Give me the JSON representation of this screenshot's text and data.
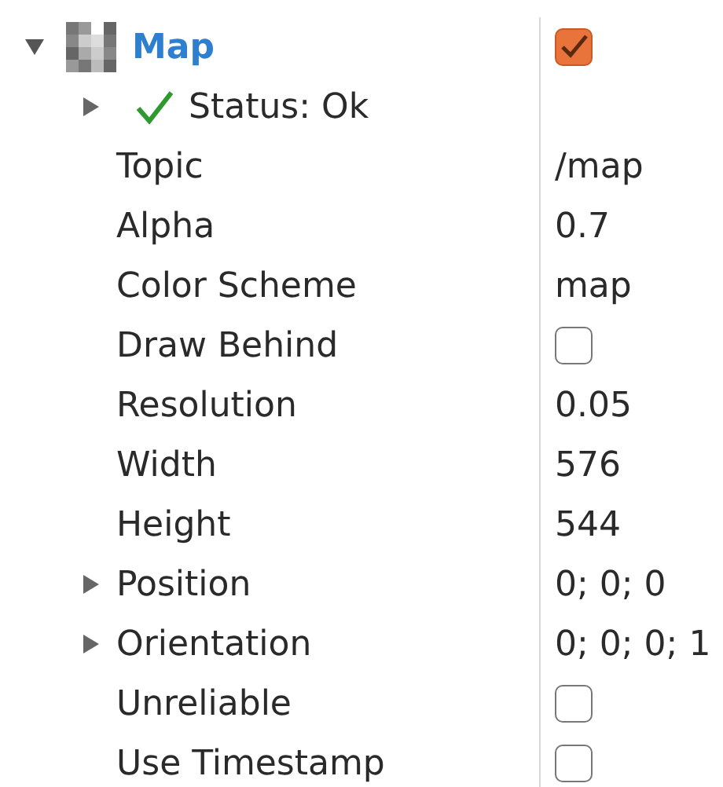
{
  "display": {
    "name": "Map",
    "expanded": true,
    "checked": true
  },
  "status": {
    "label": "Status: Ok",
    "expanded": false
  },
  "properties": [
    {
      "kind": "text",
      "label": "Topic",
      "value": "/map"
    },
    {
      "kind": "text",
      "label": "Alpha",
      "value": "0.7"
    },
    {
      "kind": "text",
      "label": "Color Scheme",
      "value": "map"
    },
    {
      "kind": "checkbox",
      "label": "Draw Behind",
      "checked": false
    },
    {
      "kind": "text",
      "label": "Resolution",
      "value": "0.05"
    },
    {
      "kind": "text",
      "label": "Width",
      "value": "576"
    },
    {
      "kind": "text",
      "label": "Height",
      "value": "544"
    },
    {
      "kind": "group",
      "label": "Position",
      "value": "0; 0; 0",
      "expanded": false
    },
    {
      "kind": "group",
      "label": "Orientation",
      "value": "0; 0; 0; 1",
      "expanded": false
    },
    {
      "kind": "checkbox",
      "label": "Unreliable",
      "checked": false
    },
    {
      "kind": "checkbox",
      "label": "Use Timestamp",
      "checked": false
    }
  ]
}
